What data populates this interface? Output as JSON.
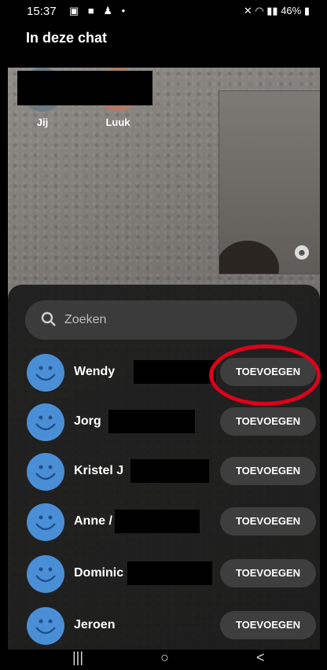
{
  "status": {
    "time": "15:37",
    "battery": "46%",
    "left_icons": "image-icon video-icon bell-icon dot",
    "right_icons": "mute wifi signal battery"
  },
  "header": {
    "title": "In deze chat"
  },
  "participants": [
    {
      "name": "Jij"
    },
    {
      "name": "Luuk"
    }
  ],
  "search": {
    "placeholder": "Zoeken"
  },
  "contacts": [
    {
      "name": "Wendy",
      "action": "TOEVOEGEN"
    },
    {
      "name": "Jorg",
      "action": "TOEVOEGEN"
    },
    {
      "name": "Kristel J",
      "action": "TOEVOEGEN"
    },
    {
      "name": "Anne /",
      "action": "TOEVOEGEN"
    },
    {
      "name": "Dominic",
      "action": "TOEVOEGEN"
    },
    {
      "name": "Jeroen",
      "action": "TOEVOEGEN"
    }
  ],
  "navbar": {
    "recents": "|||",
    "home": "○",
    "back": "<"
  },
  "colors": {
    "highlight": "#e0001a",
    "avatar": "#4a8fd6"
  }
}
